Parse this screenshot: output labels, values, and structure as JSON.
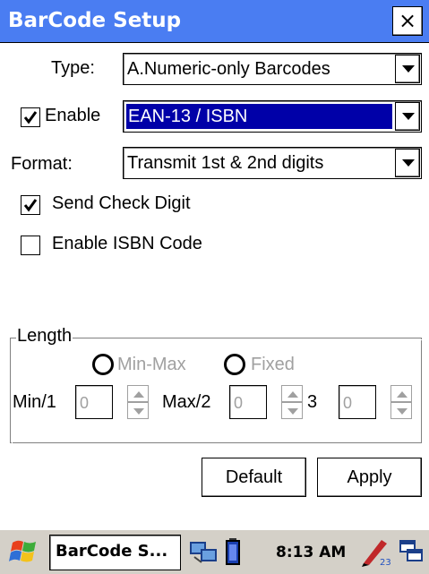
{
  "window": {
    "title": "BarCode Setup",
    "close_glyph": "×"
  },
  "form": {
    "type_label": "Type:",
    "type_value": "A.Numeric-only Barcodes",
    "enable_label": "Enable",
    "enable_checked": true,
    "symbology_value": "EAN-13 / ISBN",
    "format_label": "Format:",
    "format_value": "Transmit 1st & 2nd digits",
    "send_check_digit_label": "Send Check Digit",
    "send_check_digit_checked": true,
    "enable_isbn_label": "Enable ISBN Code",
    "enable_isbn_checked": false
  },
  "length": {
    "group_label": "Length",
    "minmax_label": "Min-Max",
    "fixed_label": "Fixed",
    "min_label": "Min/1",
    "min_value": "0",
    "max_label": "Max/2",
    "max_value": "0",
    "third_label": "3",
    "third_value": "0"
  },
  "buttons": {
    "default_label": "Default",
    "apply_label": "Apply"
  },
  "taskbar": {
    "task_label": "BarCode S...",
    "clock": "8:13 AM",
    "icons": [
      "start-flag-icon",
      "network-icon",
      "battery-icon",
      "input-panel-icon",
      "windows-switch-icon"
    ]
  },
  "colors": {
    "titlebar": "#4a7df2",
    "selection": "#0000a8",
    "taskbar": "#d4d0c8"
  }
}
